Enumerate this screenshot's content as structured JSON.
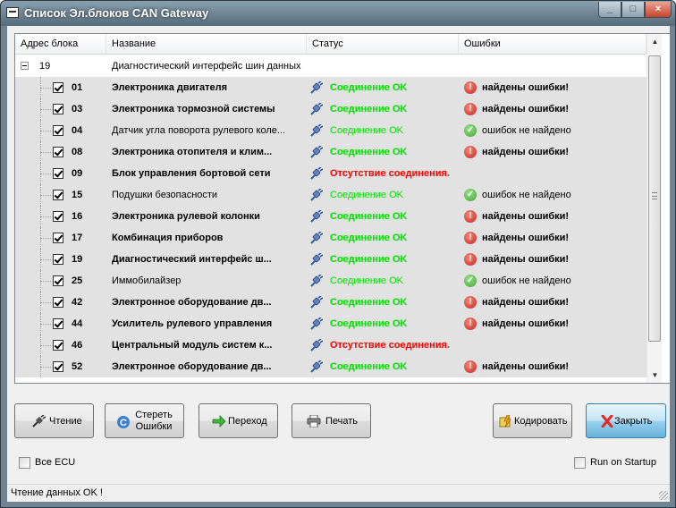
{
  "window": {
    "title": "Список Эл.блоков CAN Gateway",
    "minimize_glyph": "_",
    "maximize_glyph": "□",
    "close_glyph": "×"
  },
  "columns": [
    "Адрес блока",
    "Название",
    "Статус",
    "Ошибки"
  ],
  "root": {
    "address": "19",
    "name": "Диагностический интерфейс шин данных"
  },
  "rows": [
    {
      "address": "01",
      "name": "Электроника двигателя",
      "bold": true,
      "status": "Соединение OK",
      "status_ok": true,
      "errors": "найдены ошибки!",
      "has_errors": true
    },
    {
      "address": "03",
      "name": "Электроника тормозной системы",
      "bold": true,
      "status": "Соединение OK",
      "status_ok": true,
      "errors": "найдены ошибки!",
      "has_errors": true
    },
    {
      "address": "04",
      "name": "Датчик угла поворота рулевого коле...",
      "bold": false,
      "status": "Соединение OK",
      "status_ok": true,
      "errors": "ошибок не найдено",
      "has_errors": false
    },
    {
      "address": "08",
      "name": "Электроника отопителя и клим...",
      "bold": true,
      "status": "Соединение OK",
      "status_ok": true,
      "errors": "найдены ошибки!",
      "has_errors": true
    },
    {
      "address": "09",
      "name": "Блок управления бортовой сети",
      "bold": true,
      "status": "Отсутствие соединения.",
      "status_ok": false,
      "errors": "",
      "has_errors": null
    },
    {
      "address": "15",
      "name": "Подушки безопасности",
      "bold": false,
      "status": "Соединение OK",
      "status_ok": true,
      "errors": "ошибок не найдено",
      "has_errors": false
    },
    {
      "address": "16",
      "name": "Электроника рулевой колонки",
      "bold": true,
      "status": "Соединение OK",
      "status_ok": true,
      "errors": "найдены ошибки!",
      "has_errors": true
    },
    {
      "address": "17",
      "name": "Комбинация приборов",
      "bold": true,
      "status": "Соединение OK",
      "status_ok": true,
      "errors": "найдены ошибки!",
      "has_errors": true
    },
    {
      "address": "19",
      "name": "Диагностический интерфейс ш...",
      "bold": true,
      "status": "Соединение OK",
      "status_ok": true,
      "errors": "найдены ошибки!",
      "has_errors": true
    },
    {
      "address": "25",
      "name": "Иммобилайзер",
      "bold": false,
      "status": "Соединение OK",
      "status_ok": true,
      "errors": "ошибок не найдено",
      "has_errors": false
    },
    {
      "address": "42",
      "name": "Электронное оборудование дв...",
      "bold": true,
      "status": "Соединение OK",
      "status_ok": true,
      "errors": "найдены ошибки!",
      "has_errors": true
    },
    {
      "address": "44",
      "name": "Усилитель рулевого управления",
      "bold": true,
      "status": "Соединение OK",
      "status_ok": true,
      "errors": "найдены ошибки!",
      "has_errors": true
    },
    {
      "address": "46",
      "name": "Центральный модуль систем к...",
      "bold": true,
      "status": "Отсутствие соединения.",
      "status_ok": false,
      "errors": "",
      "has_errors": null
    },
    {
      "address": "52",
      "name": "Электронное оборудование дв...",
      "bold": true,
      "status": "Соединение OK",
      "status_ok": true,
      "errors": "найдены ошибки!",
      "has_errors": true
    }
  ],
  "buttons": {
    "read": "Чтение",
    "clear_line1": "Стереть",
    "clear_line2": "Ошибки",
    "goto": "Переход",
    "print": "Печать",
    "code": "Кодировать",
    "close": "Закрыть"
  },
  "options": {
    "all_ecu": "Все ECU",
    "all_ecu_checked": false,
    "run_on_startup": "Run on Startup",
    "run_on_startup_checked": false
  },
  "status_bar": "Чтение данных OK !",
  "colors": {
    "ok": "#00e000",
    "bad": "#ff0000",
    "error_icon": "#c8251a",
    "ok_icon": "#3ea52c",
    "focus_button": "#98d1ef"
  }
}
